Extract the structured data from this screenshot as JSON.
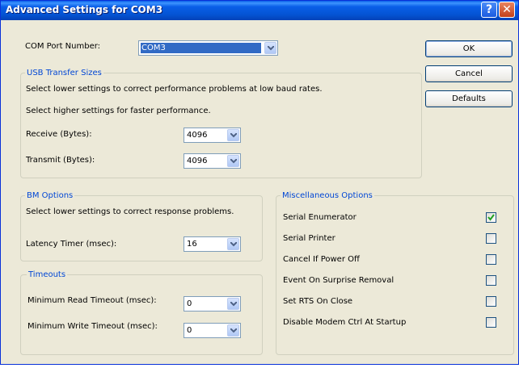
{
  "window": {
    "title": "Advanced Settings for COM3",
    "help_glyph": "?",
    "close_glyph": "✕"
  },
  "com_port": {
    "label": "COM Port Number:",
    "value": "COM3"
  },
  "usb": {
    "legend": "USB Transfer Sizes",
    "hint1": "Select lower settings to correct performance problems at low baud rates.",
    "hint2": "Select higher settings for faster performance.",
    "receive_label": "Receive (Bytes):",
    "receive_value": "4096",
    "transmit_label": "Transmit (Bytes):",
    "transmit_value": "4096"
  },
  "bm": {
    "legend": "BM Options",
    "hint": "Select lower settings to correct response problems.",
    "latency_label": "Latency Timer (msec):",
    "latency_value": "16"
  },
  "timeouts": {
    "legend": "Timeouts",
    "read_label": "Minimum Read Timeout (msec):",
    "read_value": "0",
    "write_label": "Minimum Write Timeout (msec):",
    "write_value": "0"
  },
  "misc": {
    "legend": "Miscellaneous Options",
    "options": [
      {
        "label": "Serial Enumerator",
        "checked": true
      },
      {
        "label": "Serial Printer",
        "checked": false
      },
      {
        "label": "Cancel If Power Off",
        "checked": false
      },
      {
        "label": "Event On Surprise Removal",
        "checked": false
      },
      {
        "label": "Set RTS On Close",
        "checked": false
      },
      {
        "label": "Disable Modem Ctrl At Startup",
        "checked": false
      }
    ]
  },
  "buttons": {
    "ok": "OK",
    "cancel": "Cancel",
    "defaults": "Defaults"
  },
  "colors": {
    "accent": "#0046d5",
    "selection": "#316ac5",
    "check": "#21a121"
  }
}
